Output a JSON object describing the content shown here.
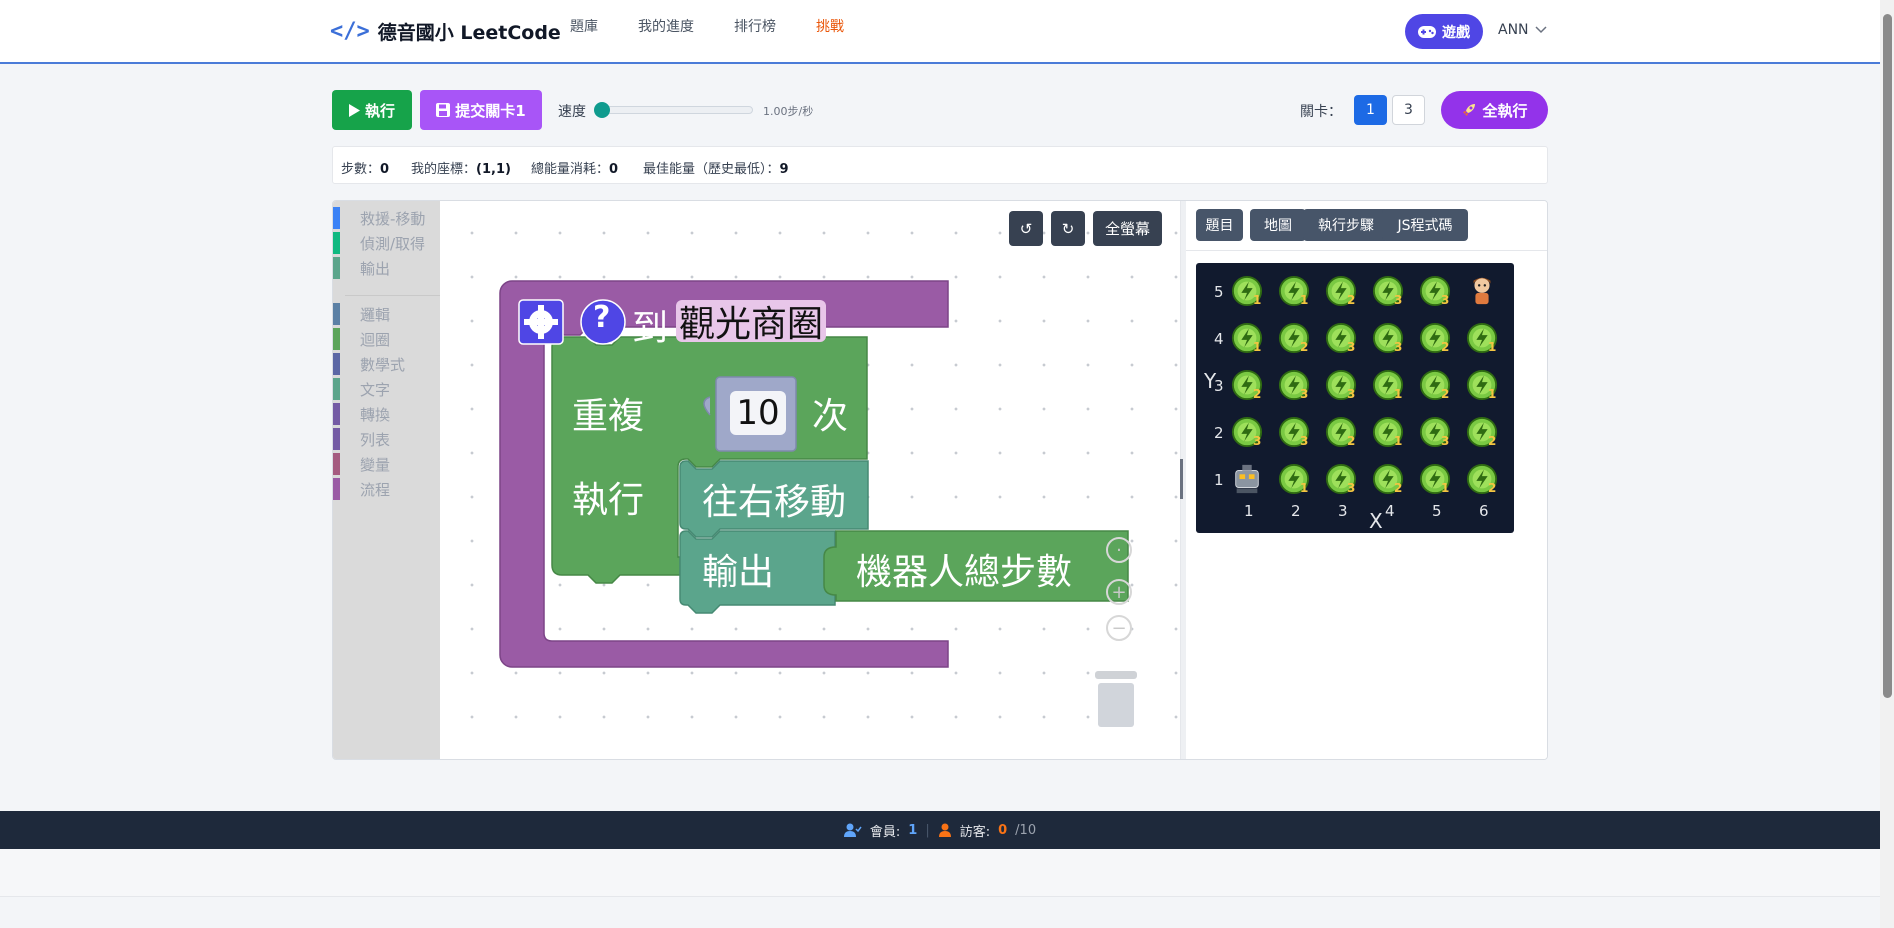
{
  "navbar": {
    "brand_icon": "</>",
    "brand": "德音國小 LeetCode",
    "links": [
      "題庫",
      "我的進度",
      "排行榜",
      "挑戰"
    ],
    "game_button": "遊戲",
    "game_icon": "gamepad-icon",
    "user": "ANN"
  },
  "toolbar": {
    "run": "執行",
    "submit": "提交關卡1",
    "speed_label": "速度",
    "speed_value": "1.00步/秒",
    "speed_fraction": 0,
    "level_label": "關卡：",
    "levels": [
      "1",
      "3"
    ],
    "active_level": "1",
    "run_all": "全執行"
  },
  "stats": {
    "steps_label": "步數：",
    "steps": "0",
    "coord_label": "我的座標：",
    "coord": "(1,1)",
    "energy_label": "總能量消耗：",
    "energy": "0",
    "best_label": "最佳能量（歷史最低）：",
    "best": "9"
  },
  "toolbox": {
    "categories": [
      {
        "label": "救援-移動",
        "color": "#3b82f6"
      },
      {
        "label": "偵測/取得",
        "color": "#10b981"
      },
      {
        "label": "輸出",
        "color": "#5ba58c"
      },
      {
        "label": "邏輯",
        "color": "#5b80a5"
      },
      {
        "label": "迴圈",
        "color": "#5ba55b"
      },
      {
        "label": "數學式",
        "color": "#5b67a5"
      },
      {
        "label": "文字",
        "color": "#5ba58c"
      },
      {
        "label": "轉換",
        "color": "#745ba5"
      },
      {
        "label": "列表",
        "color": "#745ba5"
      },
      {
        "label": "變量",
        "color": "#a55b80"
      },
      {
        "label": "流程",
        "color": "#9a5ba5"
      }
    ]
  },
  "canvas": {
    "undo": "↺",
    "redo": "↻",
    "fullscreen": "全螢幕",
    "blocks": {
      "proc_to": "到",
      "proc_name": "觀光商圈",
      "repeat": "重複",
      "repeat_count": "10",
      "times": "次",
      "do": "執行",
      "move_right": "往右移動",
      "output": "輸出",
      "total_steps": "機器人總步數"
    }
  },
  "panel": {
    "tabs": [
      "題目",
      "地圖",
      "執行步驟",
      "JS程式碼"
    ],
    "map": {
      "x_axis": "X",
      "y_axis": "Y",
      "x_values": [
        "1",
        "2",
        "3",
        "4",
        "5",
        "6"
      ],
      "y_values": [
        "5",
        "4",
        "3",
        "2",
        "1"
      ],
      "rows": [
        [
          "1",
          "1",
          "2",
          "3",
          "3",
          ""
        ],
        [
          "1",
          "2",
          "3",
          "3",
          "2",
          "1"
        ],
        [
          "2",
          "3",
          "3",
          "1",
          "2",
          "1"
        ],
        [
          "3",
          "3",
          "2",
          "1",
          "3",
          "2"
        ],
        [
          "",
          "1",
          "3",
          "2",
          "1",
          "2"
        ]
      ],
      "colors": {
        "coin": "#7ac943",
        "coin_dark": "#2f6b12",
        "number": "#f4c542",
        "background": "#111a2e"
      }
    }
  },
  "footer": {
    "member_label": "會員:",
    "members": "1",
    "visitor_label": "訪客:",
    "visitors": "0",
    "visitor_max": "/10"
  }
}
